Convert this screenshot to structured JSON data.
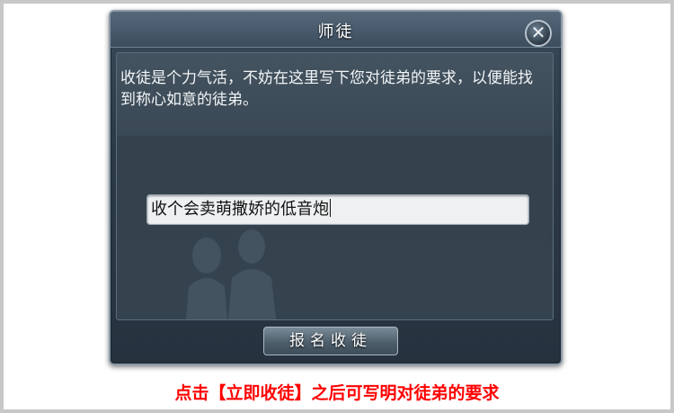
{
  "dialog": {
    "title": "师徒",
    "close_symbol": "✕",
    "instruction": "收徒是个力气活，不妨在这里写下您对徒弟的要求，以便能找到称心如意的徒弟。",
    "input_value": "收个会卖萌撒娇的低音炮",
    "signup_button_label": "报名收徒"
  },
  "caption": "点击【立即收徒】之后可写明对徒弟的要求"
}
